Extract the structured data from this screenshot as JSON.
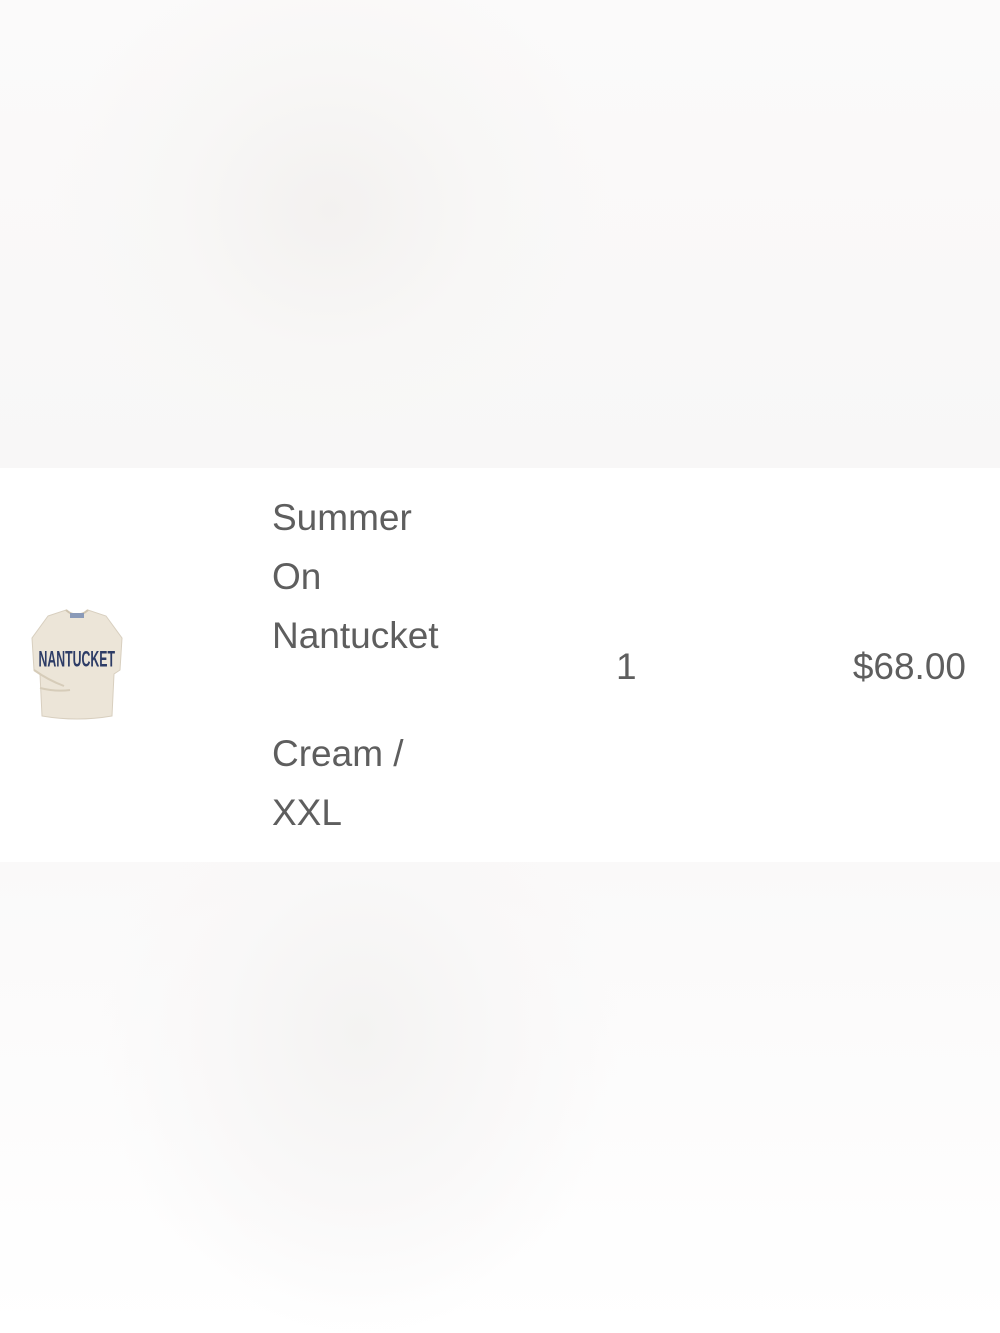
{
  "cart_item": {
    "title_lines": [
      "Summer",
      "On",
      "Nantucket"
    ],
    "variant_lines": [
      "Cream /",
      "XXL"
    ],
    "quantity": "1",
    "price": "$68.00",
    "thumbnail": {
      "icon": "sweatshirt-thumbnail",
      "print_text": "NANTUCKET",
      "garment_color": "#ece5d8",
      "print_color": "#2d3c66"
    }
  }
}
